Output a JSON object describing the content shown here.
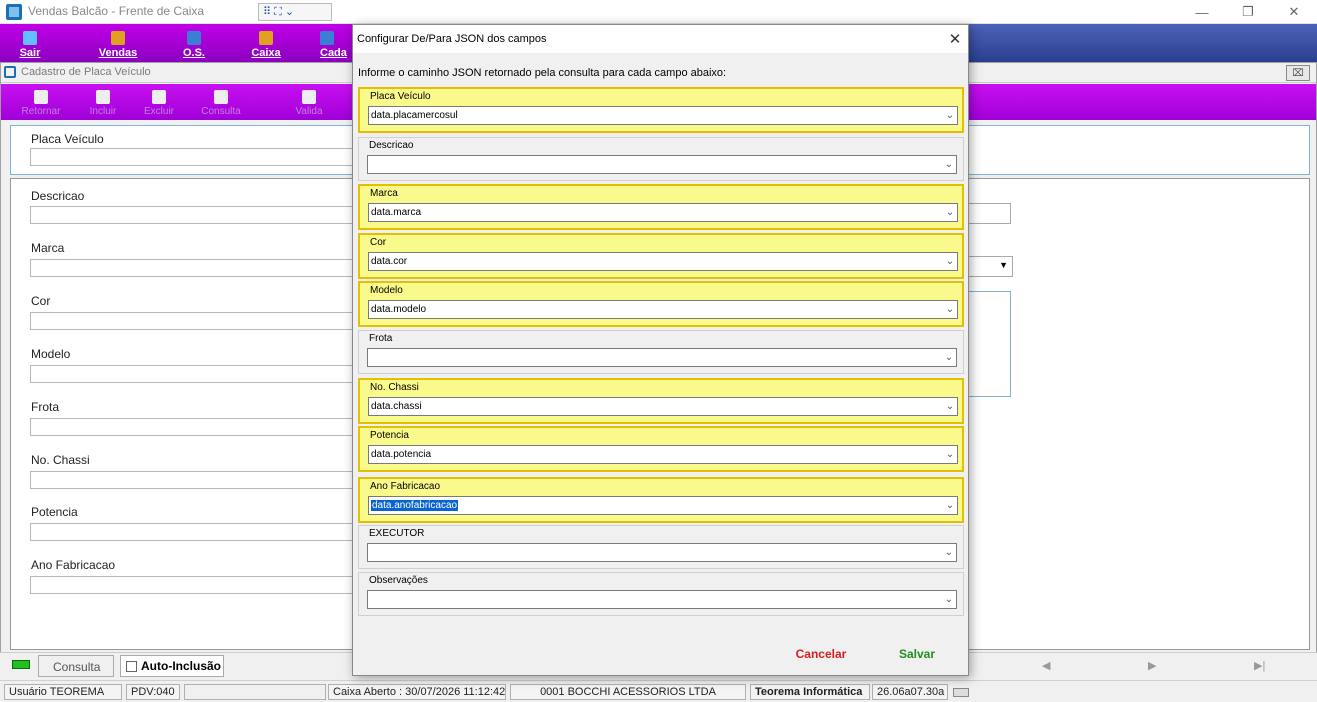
{
  "window": {
    "title": "Vendas Balcão - Frente de Caixa",
    "quick_toolbar": "⠿ ⛶ ⌄",
    "controls": [
      "—",
      "❐",
      "✕"
    ]
  },
  "menubar": {
    "items": [
      {
        "label": "Sair",
        "icon": "exit-icon",
        "color": "#60c0ff"
      },
      {
        "label": "Vendas",
        "icon": "cart-icon",
        "color": "#e0a020"
      },
      {
        "label": "O.S.",
        "icon": "tools-icon",
        "color": "#3a7fd5"
      },
      {
        "label": "Caixa",
        "icon": "cash-icon",
        "color": "#e0a020"
      },
      {
        "label": "Cada",
        "icon": "register-icon",
        "color": "#3a7fd5"
      }
    ]
  },
  "form": {
    "title": "Cadastro de Placa Veículo",
    "close": "⌧",
    "toolbar": [
      {
        "label": "Retornar",
        "icon": "return-icon"
      },
      {
        "label": "Incluir",
        "icon": "plus-icon"
      },
      {
        "label": "Excluir",
        "icon": "trash-icon"
      },
      {
        "label": "Consulta",
        "icon": "magnifier-icon"
      },
      {
        "label": "Valida",
        "icon": "validate-icon"
      }
    ],
    "fields": {
      "placa": "Placa Veículo",
      "descricao": "Descricao",
      "marca": "Marca",
      "cor": "Cor",
      "modelo": "Modelo",
      "frota": "Frota",
      "chassi": "No. Chassi",
      "potencia": "Potencia",
      "ano": "Ano Fabricacao"
    },
    "right_select_arrow": "▼"
  },
  "bottom": {
    "tab_consulta": "Consulta",
    "auto_inclusao": "Auto-Inclusão",
    "nav": [
      "◀",
      "▶",
      "▶|"
    ]
  },
  "statusbar": {
    "usuario": "Usuário TEOREMA",
    "pdv": "PDV:040",
    "caixa": "Caixa Aberto : 30/07/2026 11:12:42",
    "empresa": "0001 BOCCHI ACESSORIOS LTDA",
    "vendor": "Teorema Informática",
    "version": "26.06a07.30a"
  },
  "dialog": {
    "title": "Configurar De/Para JSON dos campos",
    "close": "✕",
    "instruction": "Informe o caminho JSON retornado pela consulta para cada campo abaixo:",
    "highlight_color": "#fafa8c",
    "groups": [
      {
        "label": "Placa Veículo",
        "value": "data.placamercosul",
        "highlighted": true
      },
      {
        "label": "Descricao",
        "value": "",
        "highlighted": false
      },
      {
        "label": "Marca",
        "value": "data.marca",
        "highlighted": true
      },
      {
        "label": "Cor",
        "value": "data.cor",
        "highlighted": true
      },
      {
        "label": "Modelo",
        "value": "data.modelo",
        "highlighted": true
      },
      {
        "label": "Frota",
        "value": "",
        "highlighted": false
      },
      {
        "label": "No. Chassi",
        "value": "data.chassi",
        "highlighted": true
      },
      {
        "label": "Potencia",
        "value": "data.potencia",
        "highlighted": true
      },
      {
        "label": "Ano Fabricacao",
        "value": "data.anofabricacao",
        "highlighted": true,
        "selected": true
      },
      {
        "label": "EXECUTOR",
        "value": "",
        "highlighted": false
      },
      {
        "label": "Observações",
        "value": "",
        "highlighted": false
      }
    ],
    "combo_arrow": "⌄",
    "cancel_label": "Cancelar",
    "save_label": "Salvar"
  }
}
